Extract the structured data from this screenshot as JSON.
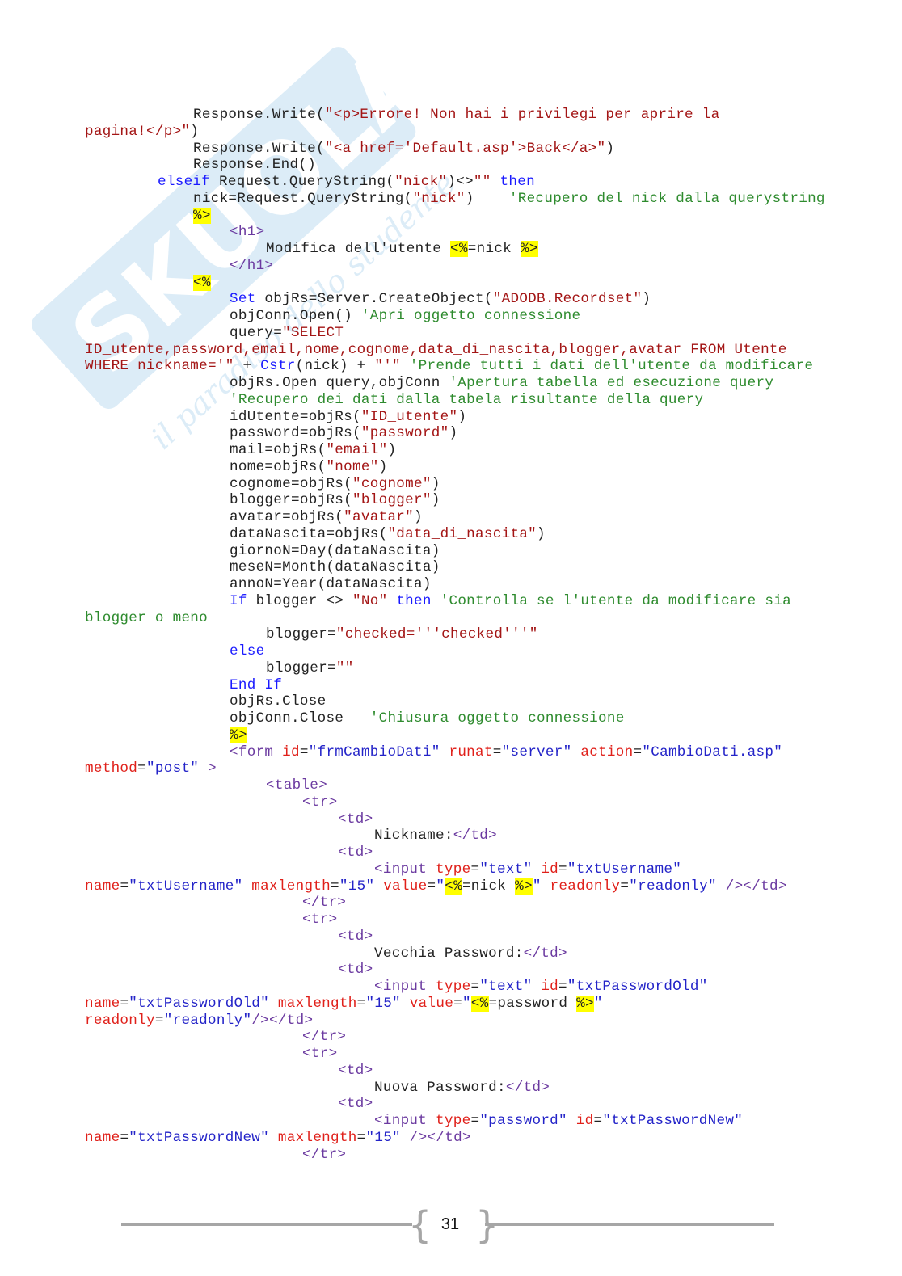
{
  "watermark": {
    "logo": "SKUOLA.net",
    "tagline": "il paradiso dello studente",
    "color": "#9ccbea"
  },
  "colors": {
    "plain": "#222222",
    "string": "#a31515",
    "keyword": "#1a1aff",
    "comment": "#2e8b2e",
    "highlight": "#ffff00",
    "attr": "#e0201a",
    "value": "#2323c8"
  },
  "lines": [
    {
      "i": 2,
      "s": [
        [
          "Response.Write(",
          "p"
        ],
        [
          "\"<p>Errore! Non hai i privilegi per aprire la",
          "s"
        ]
      ]
    },
    {
      "i": 0,
      "s": [
        [
          "pagina!</p>\"",
          "s"
        ],
        [
          ")",
          "p"
        ]
      ]
    },
    {
      "i": 2,
      "s": [
        [
          "Response.Write(",
          "p"
        ],
        [
          "\"<a href='Default.asp'>Back</a>\"",
          "s"
        ],
        [
          ")",
          "p"
        ]
      ]
    },
    {
      "i": 2,
      "s": [
        [
          "Response.End()",
          "p"
        ]
      ]
    },
    {
      "i": 1,
      "s": [
        [
          "elseif",
          "b"
        ],
        [
          " Request.QueryString(",
          "p"
        ],
        [
          "\"nick\"",
          "s"
        ],
        [
          ")<>",
          "p"
        ],
        [
          "\"\"",
          "s"
        ],
        [
          " ",
          "p"
        ],
        [
          "then",
          "b"
        ]
      ]
    },
    {
      "i": 2,
      "s": [
        [
          "nick=Request.QueryString(",
          "p"
        ],
        [
          "\"nick\"",
          "s"
        ],
        [
          ")    ",
          "p"
        ],
        [
          "'Recupero del nick dalla querystring",
          "g"
        ]
      ]
    },
    {
      "i": 2,
      "s": [
        [
          "%>",
          "h"
        ]
      ]
    },
    {
      "i": 3,
      "s": [
        [
          "<h1>",
          "t"
        ]
      ]
    },
    {
      "i": 4,
      "s": [
        [
          "Modifica dell'utente ",
          "p"
        ],
        [
          "<%",
          "h"
        ],
        [
          "=nick ",
          "p"
        ],
        [
          "%>",
          "h"
        ]
      ]
    },
    {
      "i": 3,
      "s": [
        [
          "</h1>",
          "t"
        ]
      ]
    },
    {
      "i": 2,
      "s": [
        [
          "<%",
          "h"
        ]
      ]
    },
    {
      "i": 3,
      "s": [
        [
          "Set",
          "b"
        ],
        [
          " objRs=Server.CreateObject(",
          "p"
        ],
        [
          "\"ADODB.Recordset\"",
          "s"
        ],
        [
          ")",
          "p"
        ]
      ]
    },
    {
      "i": 3,
      "s": [
        [
          "objConn.Open() ",
          "p"
        ],
        [
          "'Apri oggetto connessione",
          "g"
        ]
      ]
    },
    {
      "i": 3,
      "s": [
        [
          "query=",
          "p"
        ],
        [
          "\"SELECT",
          "s"
        ]
      ]
    },
    {
      "i": 0,
      "s": [
        [
          "ID_utente,password,email,nome,cognome,data_di_nascita,blogger,avatar FROM Utente",
          "s"
        ]
      ]
    },
    {
      "i": 0,
      "s": [
        [
          "WHERE nickname='\"",
          "s"
        ],
        [
          " + ",
          "p"
        ],
        [
          "Cstr",
          "b"
        ],
        [
          "(nick) + ",
          "p"
        ],
        [
          "\"'\"",
          "s"
        ],
        [
          " ",
          "p"
        ],
        [
          "'Prende tutti i dati dell'utente da modificare",
          "g"
        ]
      ]
    },
    {
      "i": 3,
      "s": [
        [
          "objRs.Open query,objConn ",
          "p"
        ],
        [
          "'Apertura tabella ed esecuzione query",
          "g"
        ]
      ]
    },
    {
      "i": 3,
      "s": [
        [
          "'Recupero dei dati dalla tabela risultante della query",
          "g"
        ]
      ]
    },
    {
      "i": 3,
      "s": [
        [
          "idUtente=objRs(",
          "p"
        ],
        [
          "\"ID_utente\"",
          "s"
        ],
        [
          ")",
          "p"
        ]
      ]
    },
    {
      "i": 3,
      "s": [
        [
          "password=objRs(",
          "p"
        ],
        [
          "\"password\"",
          "s"
        ],
        [
          ")",
          "p"
        ]
      ]
    },
    {
      "i": 3,
      "s": [
        [
          "mail=objRs(",
          "p"
        ],
        [
          "\"email\"",
          "s"
        ],
        [
          ")",
          "p"
        ]
      ]
    },
    {
      "i": 3,
      "s": [
        [
          "nome=objRs(",
          "p"
        ],
        [
          "\"nome\"",
          "s"
        ],
        [
          ")",
          "p"
        ]
      ]
    },
    {
      "i": 3,
      "s": [
        [
          "cognome=objRs(",
          "p"
        ],
        [
          "\"cognome\"",
          "s"
        ],
        [
          ")",
          "p"
        ]
      ]
    },
    {
      "i": 3,
      "s": [
        [
          "blogger=objRs(",
          "p"
        ],
        [
          "\"blogger\"",
          "s"
        ],
        [
          ")",
          "p"
        ]
      ]
    },
    {
      "i": 3,
      "s": [
        [
          "avatar=objRs(",
          "p"
        ],
        [
          "\"avatar\"",
          "s"
        ],
        [
          ")",
          "p"
        ]
      ]
    },
    {
      "i": 3,
      "s": [
        [
          "dataNascita=objRs(",
          "p"
        ],
        [
          "\"data_di_nascita\"",
          "s"
        ],
        [
          ")",
          "p"
        ]
      ]
    },
    {
      "i": 3,
      "s": [
        [
          "giornoN=Day(dataNascita)",
          "p"
        ]
      ]
    },
    {
      "i": 3,
      "s": [
        [
          "meseN=Month(dataNascita)",
          "p"
        ]
      ]
    },
    {
      "i": 3,
      "s": [
        [
          "annoN=Year(dataNascita)",
          "p"
        ]
      ]
    },
    {
      "i": 3,
      "s": [
        [
          "If",
          "b"
        ],
        [
          " blogger <> ",
          "p"
        ],
        [
          "\"No\"",
          "s"
        ],
        [
          " ",
          "p"
        ],
        [
          "then",
          "b"
        ],
        [
          " ",
          "p"
        ],
        [
          "'Controlla se l'utente da modificare sia",
          "g"
        ]
      ]
    },
    {
      "i": 0,
      "s": [
        [
          "blogger o meno",
          "g"
        ]
      ]
    },
    {
      "i": 4,
      "s": [
        [
          "blogger=",
          "p"
        ],
        [
          "\"checked='''checked'''\"",
          "s"
        ]
      ]
    },
    {
      "i": 3,
      "s": [
        [
          "else",
          "b"
        ]
      ]
    },
    {
      "i": 4,
      "s": [
        [
          "blogger=",
          "p"
        ],
        [
          "\"\"",
          "s"
        ]
      ]
    },
    {
      "i": 3,
      "s": [
        [
          "End If",
          "b"
        ]
      ]
    },
    {
      "i": 3,
      "s": [
        [
          "objRs.Close",
          "p"
        ]
      ]
    },
    {
      "i": 3,
      "s": [
        [
          "objConn.Close   ",
          "p"
        ],
        [
          "'Chiusura oggetto connessione",
          "g"
        ]
      ]
    },
    {
      "i": 3,
      "s": [
        [
          "%>",
          "h"
        ]
      ]
    },
    {
      "i": 3,
      "s": [
        [
          "<form",
          "t"
        ],
        [
          " id",
          "a"
        ],
        [
          "=",
          "p"
        ],
        [
          "\"frmCambioDati\"",
          "v"
        ],
        [
          " runat",
          "a"
        ],
        [
          "=",
          "p"
        ],
        [
          "\"server\"",
          "v"
        ],
        [
          " action",
          "a"
        ],
        [
          "=",
          "p"
        ],
        [
          "\"CambioDati.asp\"",
          "v"
        ]
      ]
    },
    {
      "i": 0,
      "s": [
        [
          "method",
          "a"
        ],
        [
          "=",
          "p"
        ],
        [
          "\"post\"",
          "v"
        ],
        [
          " >",
          "t"
        ]
      ]
    },
    {
      "i": 4,
      "s": [
        [
          "<table>",
          "t"
        ]
      ]
    },
    {
      "i": 5,
      "s": [
        [
          "<tr>",
          "t"
        ]
      ]
    },
    {
      "i": 6,
      "s": [
        [
          "<td>",
          "t"
        ]
      ]
    },
    {
      "i": 7,
      "s": [
        [
          "Nickname:",
          "p"
        ],
        [
          "</td>",
          "t"
        ]
      ]
    },
    {
      "i": 6,
      "s": [
        [
          "<td>",
          "t"
        ]
      ]
    },
    {
      "i": 7,
      "s": [
        [
          "<input",
          "t"
        ],
        [
          " type",
          "a"
        ],
        [
          "=",
          "p"
        ],
        [
          "\"text\"",
          "v"
        ],
        [
          " id",
          "a"
        ],
        [
          "=",
          "p"
        ],
        [
          "\"txtUsername\"",
          "v"
        ]
      ]
    },
    {
      "i": 0,
      "s": [
        [
          "name",
          "a"
        ],
        [
          "=",
          "p"
        ],
        [
          "\"txtUsername\"",
          "v"
        ],
        [
          " maxlength",
          "a"
        ],
        [
          "=",
          "p"
        ],
        [
          "\"15\"",
          "v"
        ],
        [
          " value",
          "a"
        ],
        [
          "=",
          "p"
        ],
        [
          "\"",
          "v"
        ],
        [
          "<%",
          "h"
        ],
        [
          "=nick ",
          "p"
        ],
        [
          "%>",
          "h"
        ],
        [
          "\"",
          "v"
        ],
        [
          " readonly",
          "a"
        ],
        [
          "=",
          "p"
        ],
        [
          "\"readonly\"",
          "v"
        ],
        [
          " /></td>",
          "t"
        ]
      ]
    },
    {
      "i": 5,
      "s": [
        [
          "</tr>",
          "t"
        ]
      ]
    },
    {
      "i": 5,
      "s": [
        [
          "<tr>",
          "t"
        ]
      ]
    },
    {
      "i": 6,
      "s": [
        [
          "<td>",
          "t"
        ]
      ]
    },
    {
      "i": 7,
      "s": [
        [
          "Vecchia Password:",
          "p"
        ],
        [
          "</td>",
          "t"
        ]
      ]
    },
    {
      "i": 6,
      "s": [
        [
          "<td>",
          "t"
        ]
      ]
    },
    {
      "i": 7,
      "s": [
        [
          "<input",
          "t"
        ],
        [
          " type",
          "a"
        ],
        [
          "=",
          "p"
        ],
        [
          "\"text\"",
          "v"
        ],
        [
          " id",
          "a"
        ],
        [
          "=",
          "p"
        ],
        [
          "\"txtPasswordOld\"",
          "v"
        ]
      ]
    },
    {
      "i": 0,
      "s": [
        [
          "name",
          "a"
        ],
        [
          "=",
          "p"
        ],
        [
          "\"txtPasswordOld\"",
          "v"
        ],
        [
          " maxlength",
          "a"
        ],
        [
          "=",
          "p"
        ],
        [
          "\"15\"",
          "v"
        ],
        [
          " value",
          "a"
        ],
        [
          "=",
          "p"
        ],
        [
          "\"",
          "v"
        ],
        [
          "<%",
          "h"
        ],
        [
          "=password ",
          "p"
        ],
        [
          "%>",
          "h"
        ],
        [
          "\"",
          "v"
        ]
      ]
    },
    {
      "i": 0,
      "s": [
        [
          "readonly",
          "a"
        ],
        [
          "=",
          "p"
        ],
        [
          "\"readonly\"",
          "v"
        ],
        [
          "/></td>",
          "t"
        ]
      ]
    },
    {
      "i": 5,
      "s": [
        [
          "</tr>",
          "t"
        ]
      ]
    },
    {
      "i": 5,
      "s": [
        [
          "<tr>",
          "t"
        ]
      ]
    },
    {
      "i": 6,
      "s": [
        [
          "<td>",
          "t"
        ]
      ]
    },
    {
      "i": 7,
      "s": [
        [
          "Nuova Password:",
          "p"
        ],
        [
          "</td>",
          "t"
        ]
      ]
    },
    {
      "i": 6,
      "s": [
        [
          "<td>",
          "t"
        ]
      ]
    },
    {
      "i": 7,
      "s": [
        [
          "<input",
          "t"
        ],
        [
          " type",
          "a"
        ],
        [
          "=",
          "p"
        ],
        [
          "\"password\"",
          "v"
        ],
        [
          " id",
          "a"
        ],
        [
          "=",
          "p"
        ],
        [
          "\"txtPasswordNew\"",
          "v"
        ]
      ]
    },
    {
      "i": 0,
      "s": [
        [
          "name",
          "a"
        ],
        [
          "=",
          "p"
        ],
        [
          "\"txtPasswordNew\"",
          "v"
        ],
        [
          " maxlength",
          "a"
        ],
        [
          "=",
          "p"
        ],
        [
          "\"15\"",
          "v"
        ],
        [
          " /></td>",
          "t"
        ]
      ]
    },
    {
      "i": 5,
      "s": [
        [
          "</tr>",
          "t"
        ]
      ]
    }
  ],
  "footer": {
    "page_number": "31"
  }
}
